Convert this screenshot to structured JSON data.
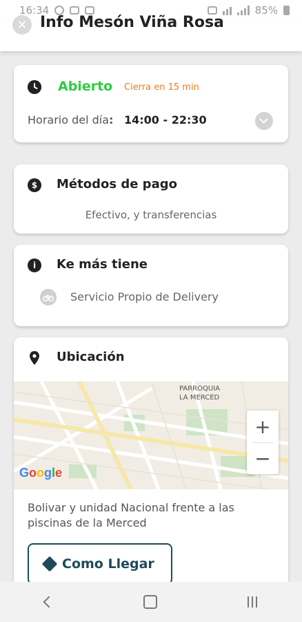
{
  "status_bar": {
    "time": "16:34",
    "battery": "85%"
  },
  "header": {
    "title": "Info Mesón Viña Rosa"
  },
  "schedule": {
    "status": "Abierto",
    "closing_note": "Cierra en 15 min",
    "hours_label": "Horario del día",
    "hours_separator": ":",
    "hours_value": "14:00 - 22:30"
  },
  "payment": {
    "title": "Métodos de pago",
    "methods": "Efectivo, y transferencias"
  },
  "extras": {
    "title": "Ke más tiene",
    "service": "Servicio Propio de Delivery"
  },
  "location": {
    "title": "Ubicación",
    "map_label_line1": "PARROQUIA",
    "map_label_line2": "LA MERCED",
    "zoom_in": "+",
    "zoom_out": "−",
    "google": "Google",
    "address": "Bolivar y unidad Nacional frente a las piscinas de la Merced",
    "directions_label": "Como Llegar"
  },
  "colors": {
    "open": "#2ecc40",
    "closing": "#f07a1f",
    "accent": "#1e4a5a"
  },
  "icons": {
    "clock": "clock-icon",
    "payment": "dollar-icon",
    "info": "info-icon",
    "pin": "map-pin-icon",
    "bike": "bicycle-icon",
    "directions": "directions-icon"
  }
}
